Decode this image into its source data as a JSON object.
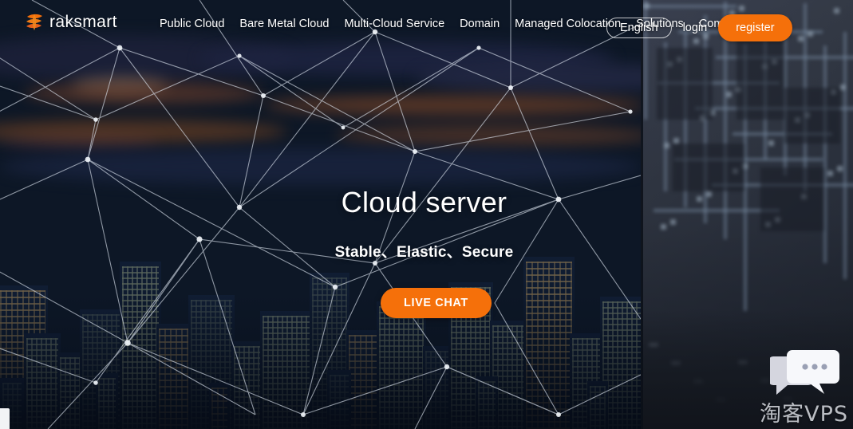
{
  "brand": {
    "name": "raksmart",
    "logo_icon": "stacked-layers-icon",
    "accent_color": "#f5700a"
  },
  "nav": {
    "items": [
      {
        "label": "Public Cloud"
      },
      {
        "label": "Bare Metal Cloud"
      },
      {
        "label": "Multi-Cloud Service"
      },
      {
        "label": "Domain"
      },
      {
        "label": "Managed Colocation"
      },
      {
        "label": "Solutions"
      },
      {
        "label": "Company"
      }
    ],
    "language_selector": "English",
    "login_label": "login",
    "register_label": "register"
  },
  "hero": {
    "title": "Cloud server",
    "subtitle": "Stable、Elastic、Secure",
    "cta_label": "LIVE CHAT"
  },
  "chat": {
    "icon": "chat-bubbles-icon"
  },
  "watermark": {
    "text": "淘客VPS"
  }
}
